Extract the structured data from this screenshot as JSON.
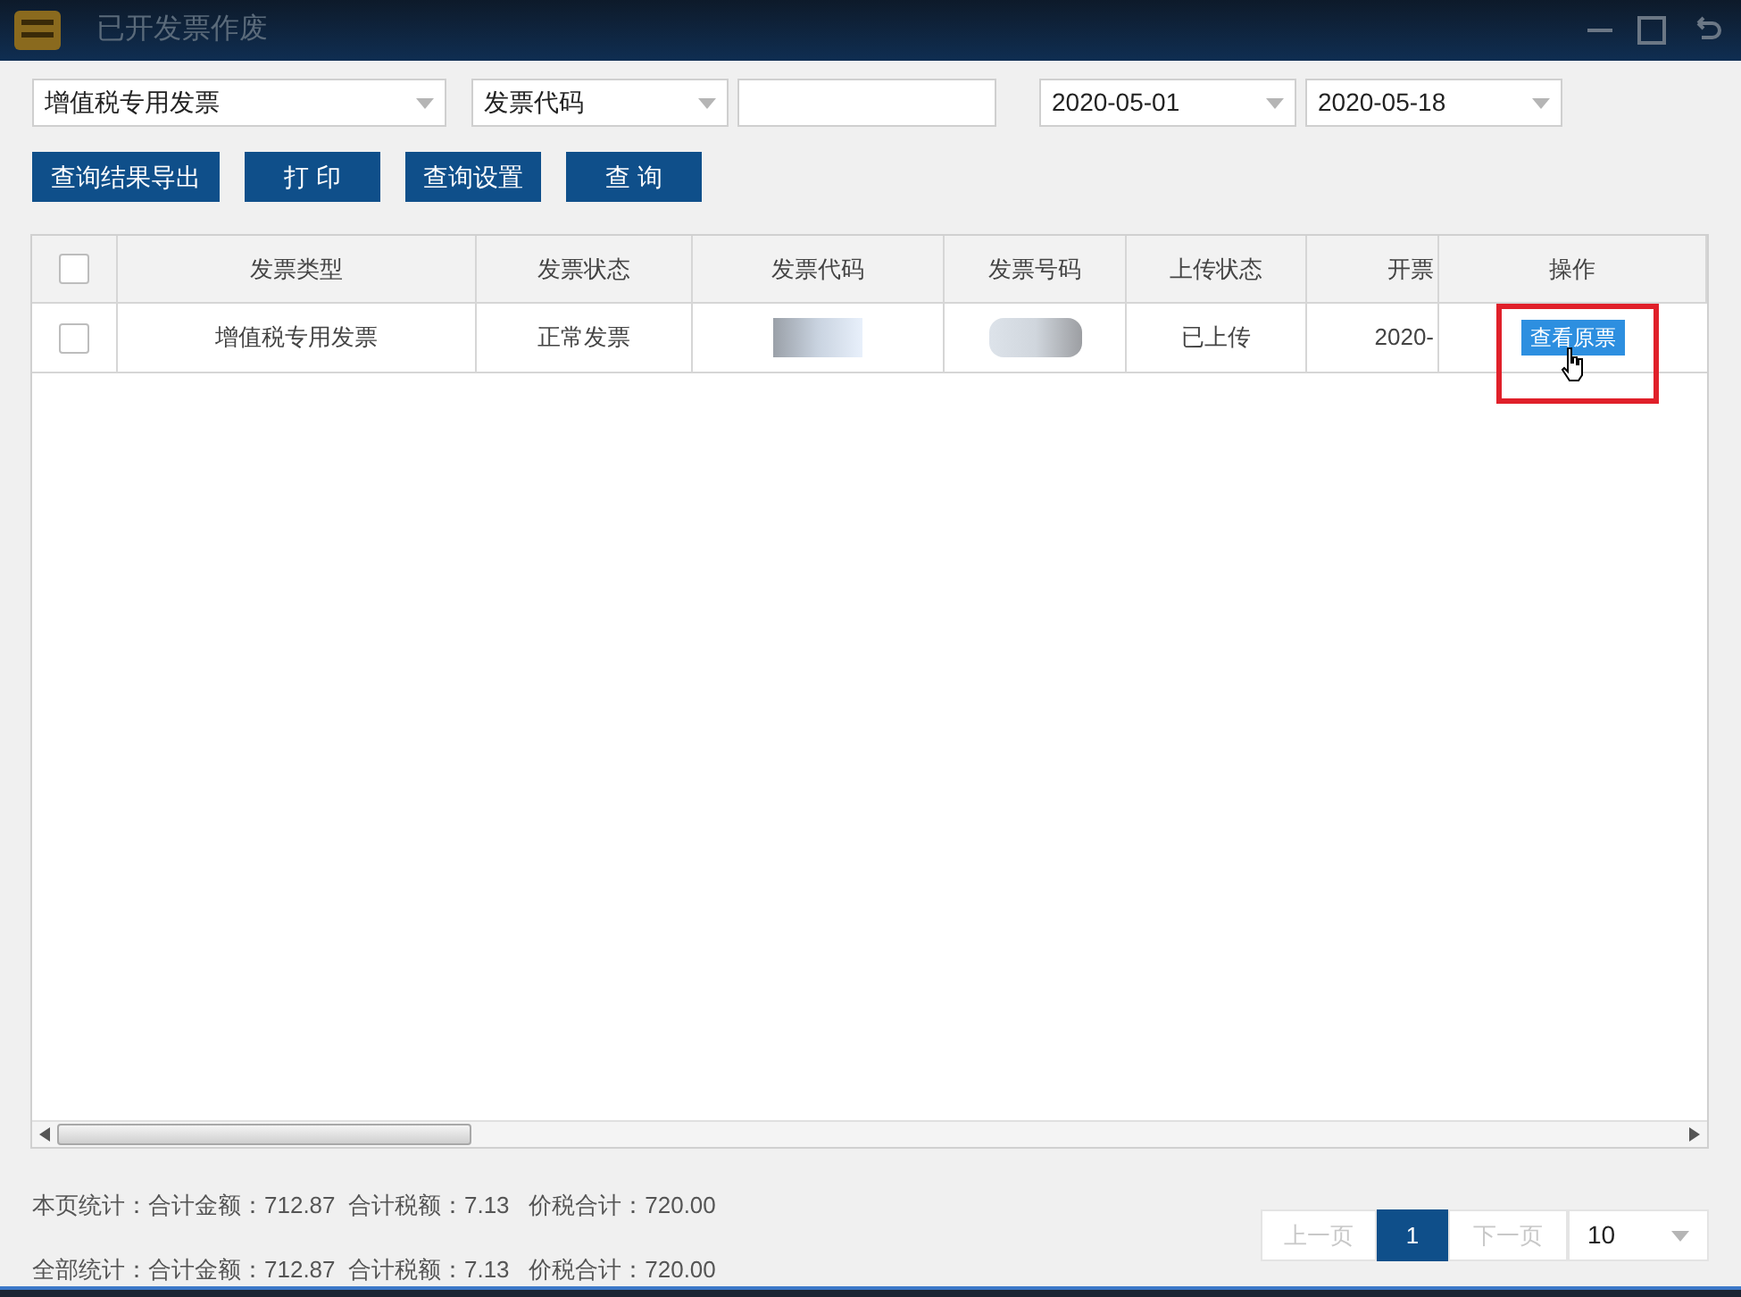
{
  "window": {
    "title": "已开发票作废"
  },
  "filters": {
    "invoice_type": "增值税专用发票",
    "search_field": "发票代码",
    "date_from": "2020-05-01",
    "date_to": "2020-05-18"
  },
  "buttons": [
    "查询结果导出",
    "打 印",
    "查询设置",
    "查 询"
  ],
  "table": {
    "select_all_checked": false,
    "columns": [
      "发票类型",
      "发票状态",
      "发票代码",
      "发票号码",
      "上传状态",
      "开票",
      "操作"
    ],
    "rows": [
      {
        "checked": false,
        "invoice_type": "增值税专用发票",
        "status": "正常发票",
        "upload_status": "已上传",
        "column_6": "2020-",
        "action": "查看原票"
      }
    ]
  },
  "summary": [
    "本页统计：合计金额：712.87  合计税额：7.13   价税合计：720.00",
    "全部统计：合计金额：712.87  合计税额：7.13   价税合计：720.00"
  ],
  "pagination": {
    "prev": "上一页",
    "pages": [
      {
        "label": "1",
        "selected": true
      }
    ],
    "next": "下一页",
    "page_size": "10"
  }
}
